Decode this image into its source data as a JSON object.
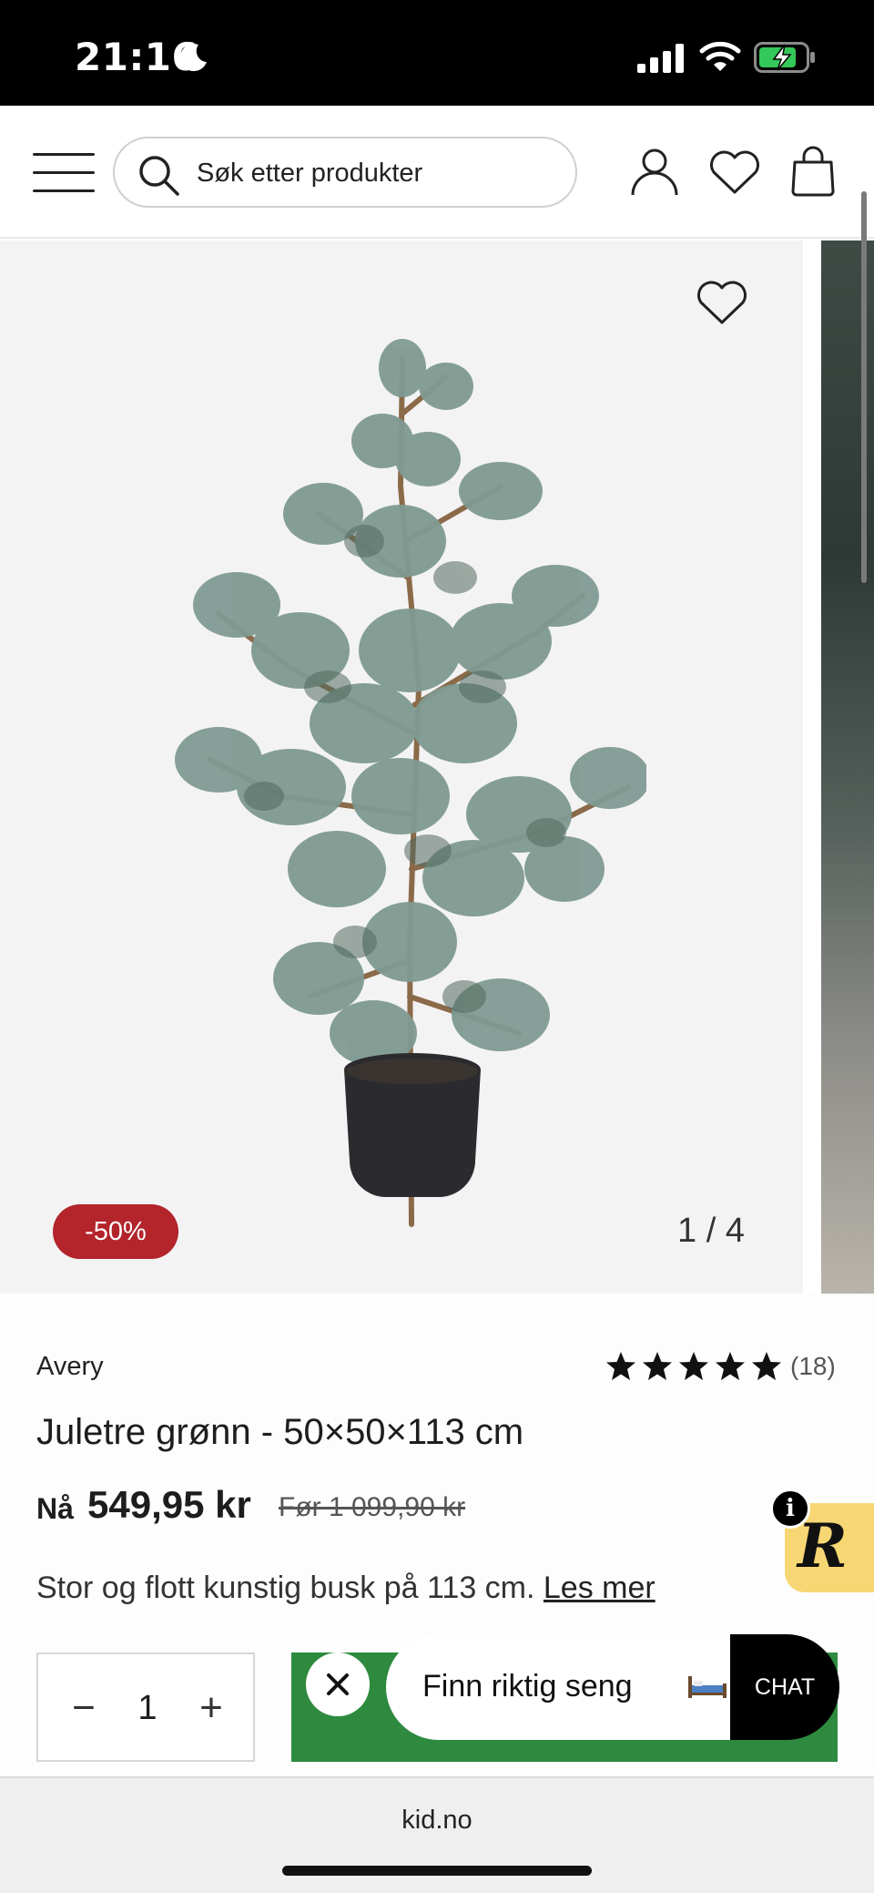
{
  "status_bar": {
    "time": "21:16"
  },
  "header": {
    "search_placeholder": "Søk etter produkter"
  },
  "gallery": {
    "discount": "-50%",
    "counter": "1 / 4"
  },
  "product": {
    "brand": "Avery",
    "rating": 5,
    "review_count": "(18)",
    "title": "Juletre grønn - 50×50×113 cm",
    "price_label": "Nå",
    "price_now": "549,95 kr",
    "price_before": "Før 1 099,90 kr",
    "description": "Stor og flott kunstig busk på 113 cm.",
    "read_more": "Les mer"
  },
  "purchase": {
    "quantity": "1",
    "minus_symbol": "−",
    "plus_symbol": "+"
  },
  "chat": {
    "prompt": "Finn riktig seng",
    "button_label": "CHAT"
  },
  "widget": {
    "info_symbol": "i",
    "letter": "R"
  },
  "browser": {
    "url": "kid.no"
  },
  "colors": {
    "discount": "#b3242b",
    "add_to_cart": "#2d8a3e",
    "widget": "#f7d774"
  }
}
